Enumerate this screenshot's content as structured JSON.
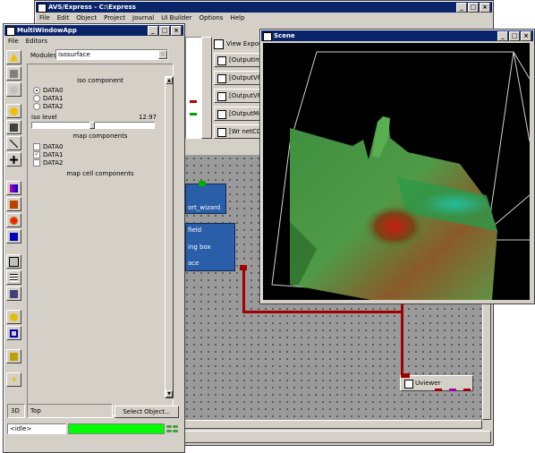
{
  "main_window": {
    "title": "AVS/Express - C:\\Express",
    "menu": [
      "File",
      "Edit",
      "Object",
      "Project",
      "Journal",
      "UI Builder",
      "Options",
      "Help"
    ],
    "view_export_label": "View Export",
    "export_items": [
      "[OutputImag",
      "[OutputVPS",
      "[OutputVRM",
      "[OutputMov",
      "[Wr netCDF"
    ]
  },
  "network": {
    "modules": [
      "ort_wizard",
      "field",
      "ing box",
      "ace"
    ],
    "uviewer_label": "Uviewer"
  },
  "mwa": {
    "title": "MultiWindowApp",
    "menu": [
      "File",
      "Editors"
    ],
    "modules_label": "Modules",
    "modules_value": "isosurface",
    "iso_component_title": "iso component",
    "iso_options": [
      "DATA0",
      "DATA1",
      "DATA2"
    ],
    "iso_selected": "DATA0",
    "iso_level_label": "iso level",
    "iso_level_value": "12.97",
    "map_components_title": "map components",
    "map_options": [
      {
        "label": "DATA0",
        "checked": false
      },
      {
        "label": "DATA1",
        "checked": true
      },
      {
        "label": "DATA2",
        "checked": false
      }
    ],
    "map_cell_title": "map cell components",
    "view_mode": "3D",
    "view_name": "Top",
    "select_object_label": "Select Object...",
    "status_text": "<idle>",
    "status_color": "#00ff00"
  },
  "scene": {
    "title": "Scene",
    "background": "#000000"
  },
  "colors": {
    "titlebar_active": "#0a246a",
    "connection": "#a00000",
    "module": "#2a5ea8"
  }
}
